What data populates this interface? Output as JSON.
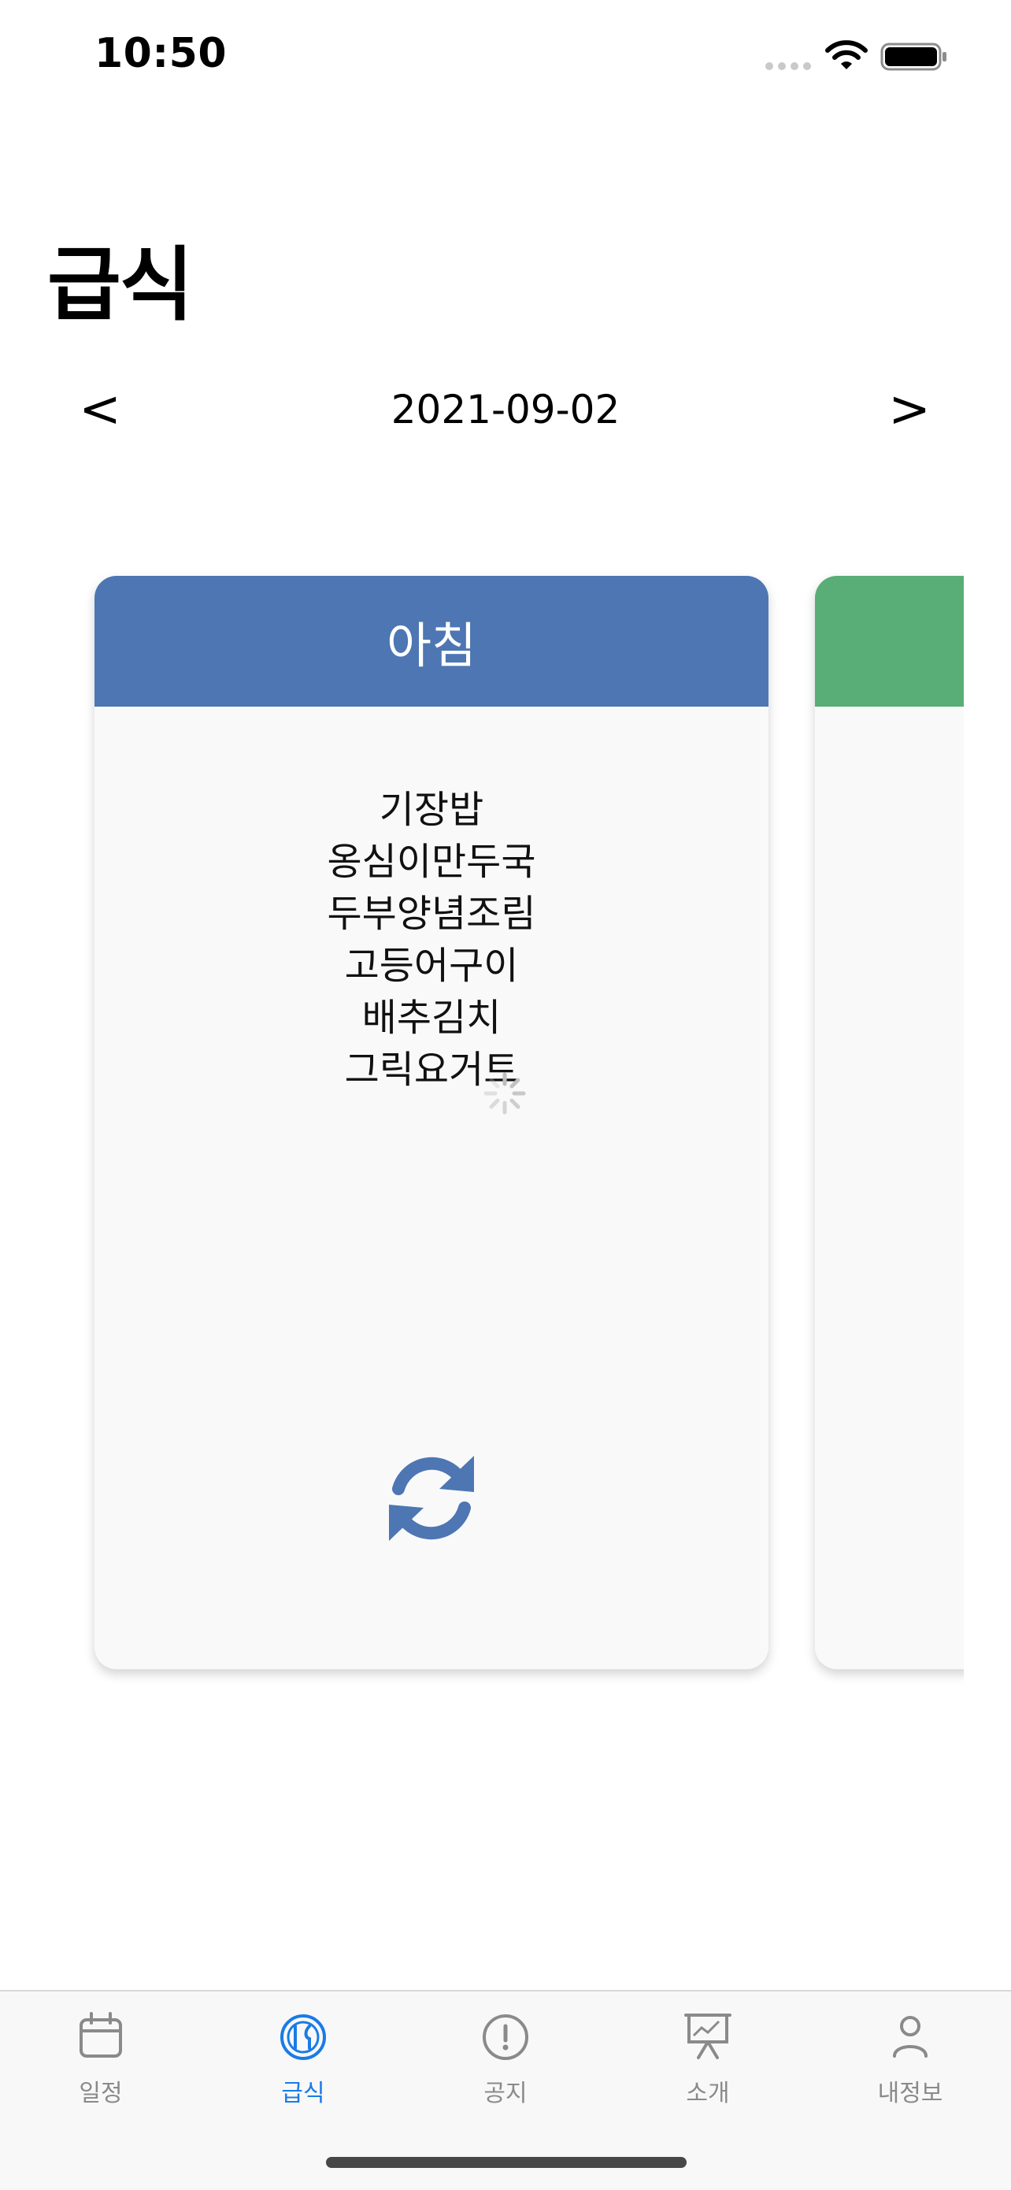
{
  "status_bar": {
    "time": "10:50"
  },
  "page": {
    "title": "급식"
  },
  "date_nav": {
    "prev_label": "<",
    "date": "2021-09-02",
    "next_label": ">"
  },
  "meal_card": {
    "title": "아침",
    "header_color": "#4d76b3",
    "items": [
      "기장밥",
      "옹심이만두국",
      "두부양념조림",
      "고등어구이",
      "배추김치",
      "그릭요거트"
    ]
  },
  "next_card": {
    "header_color": "#58ae76"
  },
  "icons": {
    "refresh": "refresh-icon",
    "spinner": "loading-spinner-icon"
  },
  "tabs": [
    {
      "label": "일정",
      "icon": "calendar-icon",
      "active": false
    },
    {
      "label": "급식",
      "icon": "meal-icon",
      "active": true
    },
    {
      "label": "공지",
      "icon": "notice-icon",
      "active": false
    },
    {
      "label": "소개",
      "icon": "presentation-icon",
      "active": false
    },
    {
      "label": "내정보",
      "icon": "profile-icon",
      "active": false
    }
  ],
  "colors": {
    "active_tab": "#1a7be6",
    "inactive_tab": "#8a8a8a",
    "refresh": "#4d76b3"
  }
}
